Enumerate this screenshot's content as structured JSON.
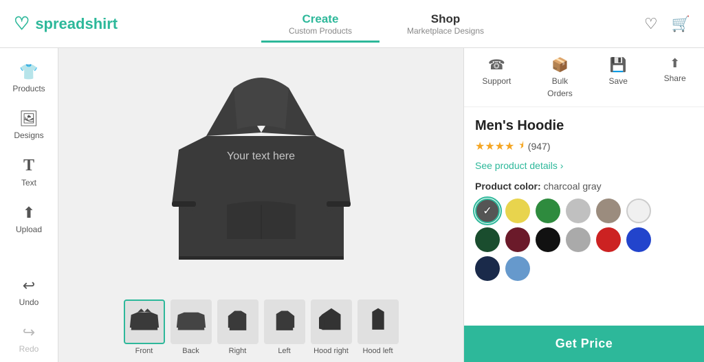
{
  "header": {
    "logo_text": "spreadshirt",
    "nav": [
      {
        "id": "create",
        "title": "Create",
        "subtitle": "Custom Products",
        "active": true
      },
      {
        "id": "shop",
        "title": "Shop",
        "subtitle": "Marketplace Designs",
        "active": false
      }
    ],
    "wishlist_icon": "♡",
    "cart_icon": "🛒"
  },
  "sidebar": {
    "items": [
      {
        "id": "products",
        "label": "Products",
        "icon": "👕"
      },
      {
        "id": "designs",
        "label": "Designs",
        "icon": "🖼"
      },
      {
        "id": "text",
        "label": "Text",
        "icon": "T"
      },
      {
        "id": "upload",
        "label": "Upload",
        "icon": "⬆"
      }
    ],
    "undo_label": "Undo",
    "redo_label": "Redo",
    "undo_icon": "↩",
    "redo_icon": "↪"
  },
  "canvas": {
    "text_overlay": "Your text here",
    "thumbnails": [
      {
        "id": "front",
        "label": "Front",
        "active": true
      },
      {
        "id": "back",
        "label": "Back",
        "active": false
      },
      {
        "id": "right",
        "label": "Right",
        "active": false
      },
      {
        "id": "left",
        "label": "Left",
        "active": false
      },
      {
        "id": "hood-right",
        "label": "Hood right",
        "active": false
      },
      {
        "id": "hood-left",
        "label": "Hood left",
        "active": false
      }
    ]
  },
  "toolbar": {
    "items": [
      {
        "id": "support",
        "label": "Support",
        "icon": "☎"
      },
      {
        "id": "bulk-orders",
        "label": "Bulk Orders",
        "icon": "📦"
      },
      {
        "id": "save",
        "label": "Save",
        "icon": "💾"
      },
      {
        "id": "share",
        "label": "Share",
        "icon": "⬆"
      }
    ]
  },
  "product": {
    "name": "Men's Hoodie",
    "rating_stars": "★★★★",
    "rating_half": "½",
    "rating_count": "(947)",
    "details_link": "See product details ›",
    "color_label": "Product color:",
    "selected_color": "charcoal gray",
    "colors": [
      {
        "id": "charcoal",
        "hex": "#555555",
        "label": "charcoal gray",
        "selected": true
      },
      {
        "id": "yellow",
        "hex": "#e8d44d",
        "label": "yellow",
        "selected": false
      },
      {
        "id": "green",
        "hex": "#2e8b3e",
        "label": "green",
        "selected": false
      },
      {
        "id": "light-gray",
        "hex": "#c0c0c0",
        "label": "light gray",
        "selected": false
      },
      {
        "id": "taupe",
        "hex": "#9b8c7e",
        "label": "taupe",
        "selected": false
      },
      {
        "id": "white",
        "hex": "#f0f0f0",
        "label": "white",
        "selected": false
      },
      {
        "id": "dark-green",
        "hex": "#1a4d2e",
        "label": "dark green",
        "selected": false
      },
      {
        "id": "burgundy",
        "hex": "#6b1a2a",
        "label": "burgundy",
        "selected": false
      },
      {
        "id": "black",
        "hex": "#111111",
        "label": "black",
        "selected": false
      },
      {
        "id": "silver",
        "hex": "#aaaaaa",
        "label": "silver",
        "selected": false
      },
      {
        "id": "red",
        "hex": "#cc2222",
        "label": "red",
        "selected": false
      },
      {
        "id": "blue",
        "hex": "#2244cc",
        "label": "blue",
        "selected": false
      },
      {
        "id": "navy",
        "hex": "#1a2a4a",
        "label": "navy",
        "selected": false
      },
      {
        "id": "light-blue",
        "hex": "#6699cc",
        "label": "light blue",
        "selected": false
      }
    ],
    "get_price_label": "Get Price"
  }
}
